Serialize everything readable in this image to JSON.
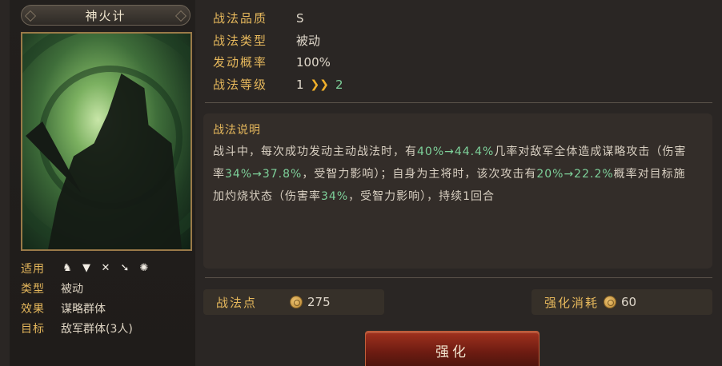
{
  "skill": {
    "name": "神火计"
  },
  "attributes": {
    "usage_label": "适用",
    "usage_icons": [
      "cavalry-icon",
      "shield-icon",
      "bow-icon",
      "spear-icon",
      "wheel-icon"
    ],
    "type_label": "类型",
    "type_value": "被动",
    "effect_label": "效果",
    "effect_value": "谋略群体",
    "target_label": "目标",
    "target_value": "敌军群体(3人)"
  },
  "info": {
    "quality_label": "战法品质",
    "quality_value": "S",
    "type_label": "战法类型",
    "type_value": "被动",
    "rate_label": "发动概率",
    "rate_value": "100%",
    "level_label": "战法等级",
    "level_current": "1",
    "level_next": "2"
  },
  "description": {
    "title": "战法说明",
    "p1": "战斗中，每次成功发动主动战法时，有",
    "h1": "40%→44.4%",
    "p2": "几率对敌军全体造成谋略攻击（伤害率",
    "h2": "34%→37.8%",
    "p3": "，受智力影响）；自身为主将时，该次攻击有",
    "h3": "20%→22.2%",
    "p4": "概率对目标施加灼烧状态（伤害率",
    "h4": "34%",
    "p5": "，受智力影响），持续1回合"
  },
  "points": {
    "label": "战法点",
    "value": "275",
    "cost_label": "强化消耗",
    "cost_value": "60"
  },
  "enhance_button": "强化",
  "colors": {
    "gold_label": "#e6b85c",
    "highlight_green": "#7ed19a",
    "button_red": "#a2321e"
  }
}
